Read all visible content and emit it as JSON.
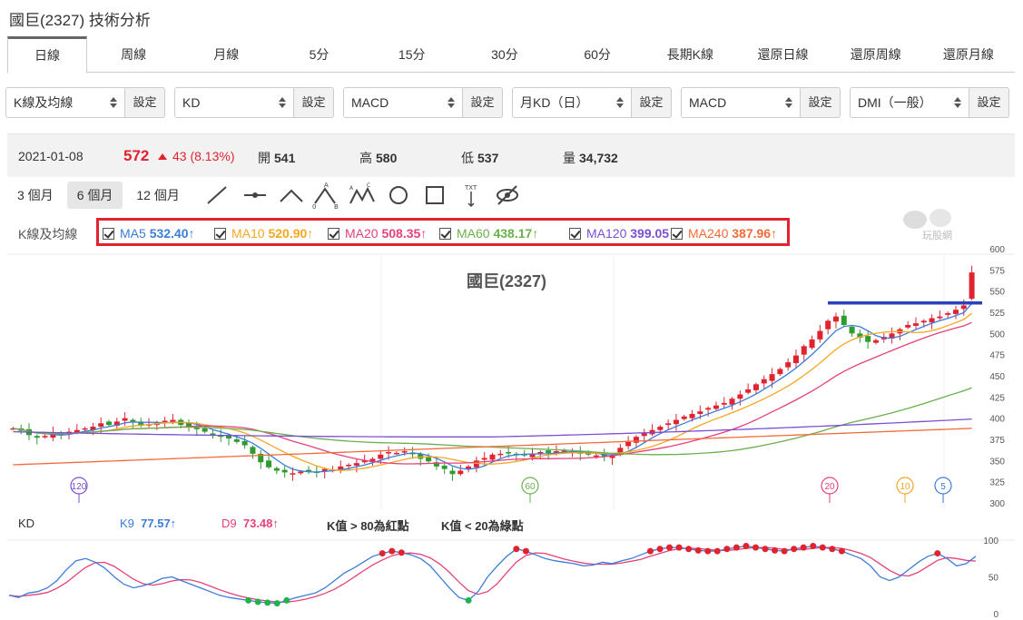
{
  "page_title": "國巨(2327) 技術分析",
  "tabs": [
    "日線",
    "周線",
    "月線",
    "5分",
    "15分",
    "30分",
    "60分",
    "長期K線",
    "還原日線",
    "還原周線",
    "還原月線"
  ],
  "active_tab": "日線",
  "selectors": [
    {
      "value": "K線及均線",
      "set": "設定"
    },
    {
      "value": "KD",
      "set": "設定"
    },
    {
      "value": "MACD",
      "set": "設定"
    },
    {
      "value": "月KD（日）",
      "set": "設定"
    },
    {
      "value": "MACD",
      "set": "設定"
    },
    {
      "value": "DMI（一般）",
      "set": "設定"
    }
  ],
  "info": {
    "date": "2021-01-08",
    "price": "572",
    "change": "43 (8.13%)",
    "open_label": "開",
    "open": "541",
    "high_label": "高",
    "high": "580",
    "low_label": "低",
    "low": "537",
    "vol_label": "量",
    "vol": "34,732"
  },
  "periods": [
    "3 個月",
    "6 個月",
    "12 個月"
  ],
  "active_period": "6 個月",
  "tool_icons": [
    "line-tool-icon",
    "horizontal-line-icon",
    "angle-tool-icon",
    "abc-pattern-icon",
    "abcd-pattern-icon",
    "circle-tool-icon",
    "rectangle-tool-icon",
    "text-tool-icon",
    "hide-icon"
  ],
  "tool_text_label": "TXT",
  "ma_section_label": "K線及均線",
  "mas": [
    {
      "label": "MA5",
      "value": "532.40↑",
      "color": "#3b7dd8"
    },
    {
      "label": "MA10",
      "value": "520.90↑",
      "color": "#f5a623"
    },
    {
      "label": "MA20",
      "value": "508.35↑",
      "color": "#e5417a"
    },
    {
      "label": "MA60",
      "value": "438.17↑",
      "color": "#6ab04c"
    },
    {
      "label": "MA120",
      "value": "399.05↑",
      "color": "#7b4fd1"
    },
    {
      "label": "MA240",
      "value": "387.96↑",
      "color": "#f26b3a"
    }
  ],
  "logo_text": "玩股網",
  "kd": {
    "label": "KD",
    "k_label": "K9",
    "k_value": "77.57↑",
    "d_label": "D9",
    "d_value": "73.48↑",
    "note1": "K值 > 80為紅點",
    "note2": "K值 < 20為綠點"
  },
  "chart_data": {
    "type": "candlestick",
    "title": "國巨(2327)",
    "y_ticks": [
      600,
      575,
      550,
      525,
      500,
      475,
      450,
      425,
      400,
      375,
      350,
      325,
      300
    ],
    "ylim": [
      300,
      600
    ],
    "kd_ticks": [
      100,
      50,
      0
    ],
    "resistance_line": 536,
    "ma_markers": [
      {
        "label": "120",
        "color": "#7b4fd1"
      },
      {
        "label": "60",
        "color": "#6ab04c"
      },
      {
        "label": "20",
        "color": "#e5417a"
      },
      {
        "label": "10",
        "color": "#f5a623"
      },
      {
        "label": "5",
        "color": "#3b7dd8"
      }
    ],
    "close": [
      388,
      385,
      380,
      377,
      379,
      383,
      381,
      384,
      386,
      388,
      390,
      394,
      392,
      396,
      400,
      396,
      391,
      393,
      395,
      397,
      398,
      392,
      390,
      387,
      384,
      380,
      378,
      376,
      372,
      368,
      358,
      348,
      342,
      338,
      336,
      335,
      337,
      338,
      336,
      340,
      339,
      343,
      345,
      347,
      350,
      352,
      357,
      360,
      359,
      361,
      358,
      352,
      349,
      343,
      340,
      334,
      338,
      343,
      350,
      353,
      357,
      358,
      359,
      357,
      356,
      358,
      360,
      359,
      361,
      362,
      360,
      358,
      357,
      356,
      355,
      357,
      365,
      372,
      378,
      383,
      386,
      390,
      394,
      398,
      402,
      405,
      408,
      412,
      415,
      418,
      423,
      428,
      434,
      440,
      446,
      452,
      458,
      466,
      474,
      485,
      493,
      503,
      515,
      520,
      510,
      500,
      495,
      490,
      492,
      496,
      500,
      505,
      510,
      512,
      515,
      518,
      520,
      524,
      528,
      533,
      572
    ],
    "k": [
      25,
      22,
      28,
      30,
      35,
      45,
      60,
      72,
      75,
      70,
      62,
      50,
      40,
      35,
      38,
      42,
      48,
      50,
      45,
      40,
      35,
      30,
      25,
      22,
      20,
      18,
      16,
      15,
      14,
      18,
      22,
      25,
      28,
      35,
      45,
      55,
      62,
      70,
      78,
      82,
      85,
      83,
      80,
      75,
      65,
      50,
      35,
      22,
      18,
      30,
      50,
      65,
      78,
      88,
      85,
      80,
      75,
      72,
      70,
      68,
      65,
      66,
      70,
      68,
      72,
      75,
      80,
      85,
      88,
      90,
      90,
      88,
      86,
      85,
      85,
      88,
      90,
      92,
      90,
      88,
      86,
      85,
      88,
      90,
      92,
      90,
      88,
      85,
      80,
      75,
      65,
      50,
      45,
      50,
      60,
      70,
      78,
      82,
      75,
      65,
      68,
      78
    ]
  }
}
